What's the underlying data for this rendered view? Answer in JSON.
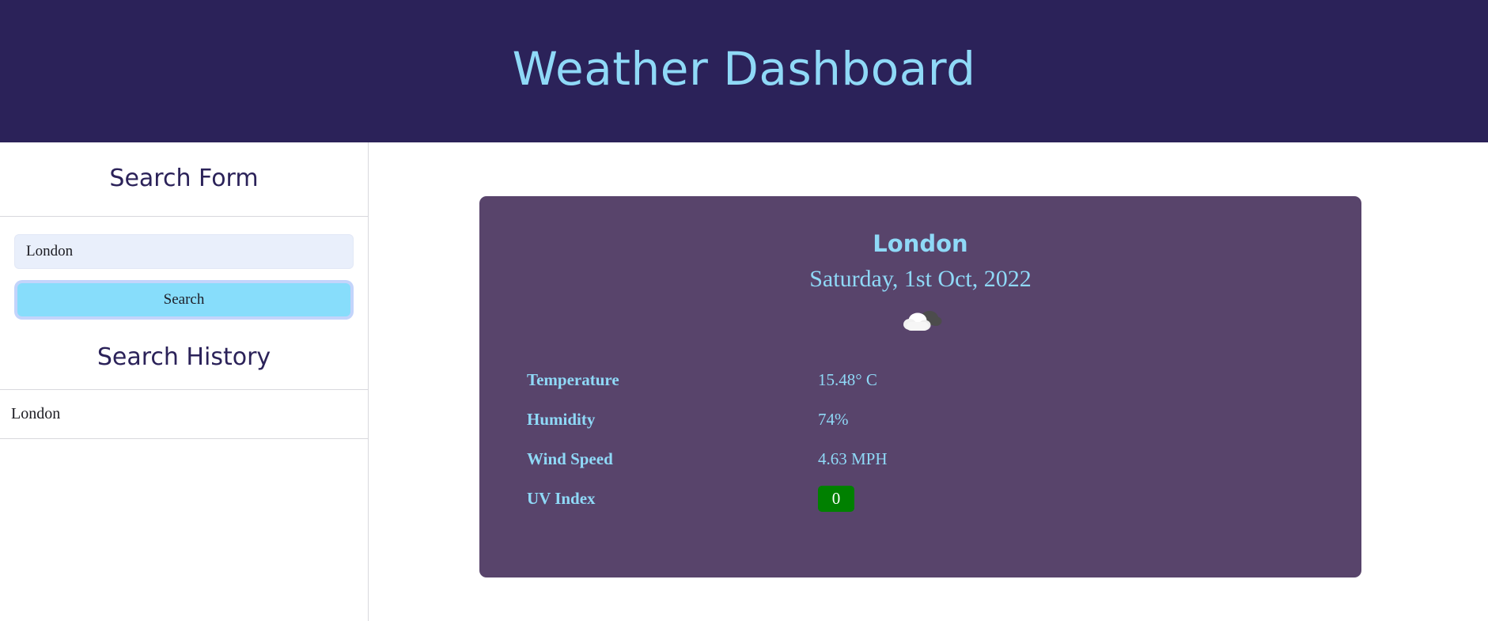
{
  "header": {
    "title": "Weather Dashboard",
    "background_color": "#2b2259",
    "title_color": "#8fd9f7"
  },
  "sidebar": {
    "search_form_heading": "Search Form",
    "city_input": {
      "value": "London",
      "placeholder": "City"
    },
    "search_button_label": "Search",
    "search_history_heading": "Search History",
    "history_items": [
      {
        "label": "London"
      }
    ]
  },
  "weather_card": {
    "city": "London",
    "date": "Saturday, 1st Oct, 2022",
    "icon": "broken-clouds-icon",
    "background_color": "#58446b",
    "text_color": "#8fd9f7",
    "details": [
      {
        "label": "Temperature",
        "value": "15.48° C",
        "type": "text"
      },
      {
        "label": "Humidity",
        "value": "74%",
        "type": "text"
      },
      {
        "label": "Wind Speed",
        "value": "4.63 MPH",
        "type": "text"
      },
      {
        "label": "UV Index",
        "value": "0",
        "type": "badge",
        "badge_color": "#008000"
      }
    ]
  }
}
